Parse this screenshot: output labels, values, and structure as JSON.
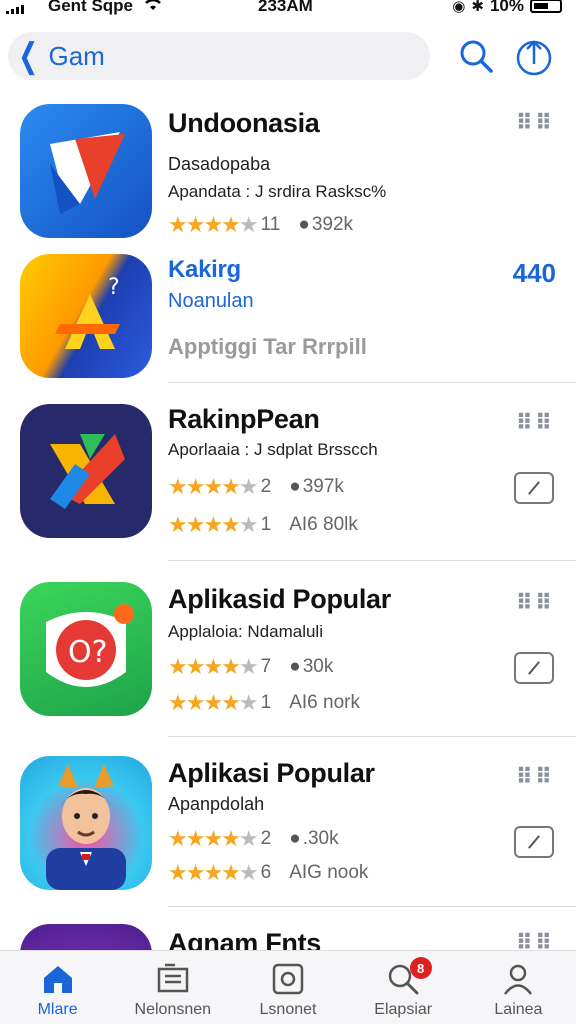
{
  "status_bar": {
    "carrier": "Gent Sqpe",
    "time": "233AM",
    "battery": "10%"
  },
  "nav": {
    "back_label": "Gam"
  },
  "apps": [
    {
      "title": "Undoonasia",
      "subtitle": "Dasadopaba",
      "subtitle2": "Apandata : J srdira Rasksc%",
      "rating_count": "11",
      "size": "392k"
    },
    {
      "title": "Kakirg",
      "subtitle": "Noanulan",
      "subtitle2": "Apptiggi Tar Rrrpill",
      "price": "440"
    },
    {
      "title": "RakinpPean",
      "subtitle": "Aporlaaia : J sdplat Brsscch",
      "rating1_count": "2",
      "rating1_size": "397k",
      "rating2_count": "1",
      "rating2_size": "AI6 80lk"
    },
    {
      "title": "Aplikasid Popular",
      "subtitle": "Applaloia: Ndamaluli",
      "rating1_count": "7",
      "rating1_size": "30k",
      "rating2_count": "1",
      "rating2_size": "AI6 nork"
    },
    {
      "title": "Aplikasi Popular",
      "subtitle": "Apanpdolah",
      "rating1_count": "2",
      "rating1_size": ".30k",
      "rating2_count": "6",
      "rating2_size": "AIG nook"
    },
    {
      "title": "Agnam Fnts"
    }
  ],
  "tabs": [
    {
      "label": "Mlare"
    },
    {
      "label": "Nelonsnen"
    },
    {
      "label": "Lsnonet"
    },
    {
      "label": "Elapsiar",
      "badge": "8"
    },
    {
      "label": "Lainea"
    }
  ],
  "colors": {
    "accent": "#1a66d9",
    "star": "#f5a623",
    "badge": "#e02020"
  }
}
